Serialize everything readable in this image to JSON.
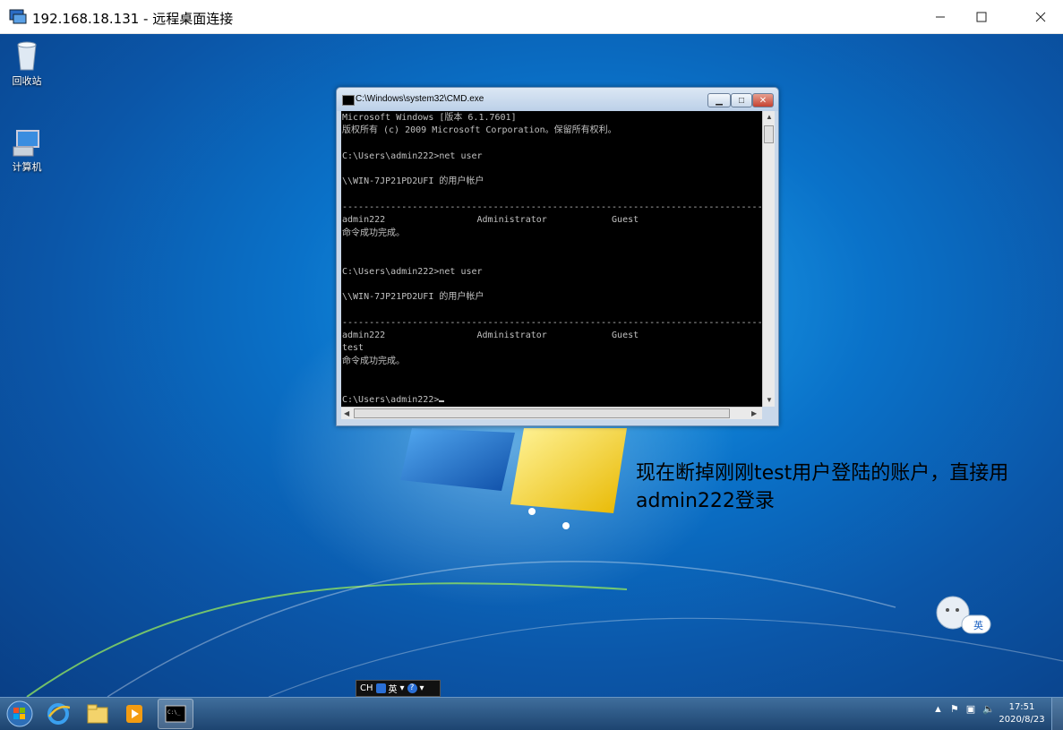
{
  "rdp": {
    "title": "192.168.18.131 - 远程桌面连接"
  },
  "desktop": {
    "icons": [
      {
        "label": "回收站",
        "icon": "recycle-bin-icon"
      },
      {
        "label": "计算机",
        "icon": "computer-icon"
      }
    ],
    "annotation": "现在断掉刚刚test用户登陆的账户，直接用admin222登录"
  },
  "cmd": {
    "title": "C:\\Windows\\system32\\CMD.exe",
    "lines": [
      "Microsoft Windows [版本 6.1.7601]",
      "版权所有 (c) 2009 Microsoft Corporation。保留所有权利。",
      "",
      "C:\\Users\\admin222>net user",
      "",
      "\\\\WIN-7JP21PD2UFI 的用户帐户",
      "",
      "-------------------------------------------------------------------------------",
      "admin222                 Administrator            Guest",
      "命令成功完成。",
      "",
      "",
      "C:\\Users\\admin222>net user",
      "",
      "\\\\WIN-7JP21PD2UFI 的用户帐户",
      "",
      "-------------------------------------------------------------------------------",
      "admin222                 Administrator            Guest",
      "test",
      "命令成功完成。",
      "",
      "",
      "C:\\Users\\admin222>"
    ]
  },
  "ime": {
    "lang": "CH",
    "mode": "英",
    "help": "?"
  },
  "assistant": {
    "label": "英"
  },
  "taskbar": {
    "items": [
      "start-orb",
      "internet-explorer",
      "file-explorer",
      "media-player",
      "cmd"
    ],
    "clock_time": "17:51",
    "clock_date": "2020/8/23"
  }
}
